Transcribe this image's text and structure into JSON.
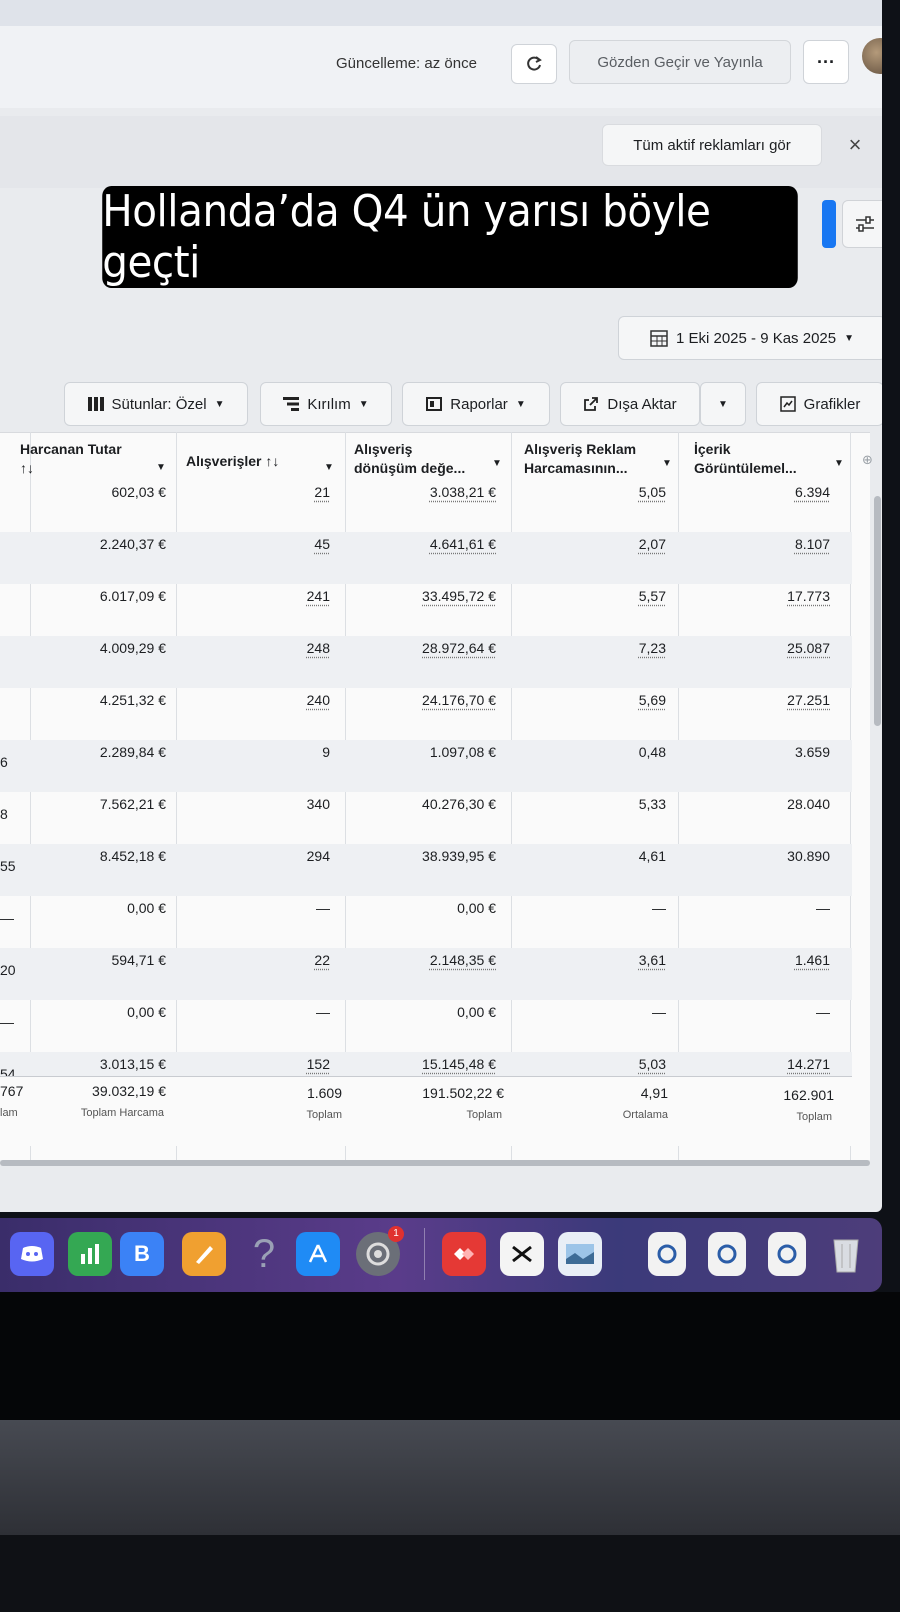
{
  "header": {
    "update_status": "Güncelleme: az önce",
    "review_publish": "Gözden Geçir ve Yayınla",
    "more": "···"
  },
  "banner": {
    "all_active_ads": "Tüm aktif reklamları gör",
    "close": "×"
  },
  "overlay_caption": "Hollanda’da Q4 ün yarısı böyle geçti",
  "date_range": "1 Eki 2025 - 9 Kas 2025",
  "toolbar": {
    "columns": "Sütunlar: Özel",
    "breakdown": "Kırılım",
    "reports": "Raporlar",
    "export": "Dışa Aktar",
    "charts": "Grafikler"
  },
  "table": {
    "headers": [
      {
        "line1": "Harcanan Tutar",
        "line2": "↑↓"
      },
      {
        "line1": "Alışverişler ↑↓",
        "line2": ""
      },
      {
        "line1": "Alışveriş",
        "line2": "dönüşüm değe..."
      },
      {
        "line1": "Alışveriş Reklam",
        "line2": "Harcamasının..."
      },
      {
        "line1": "İçerik",
        "line2": "Görüntülemel..."
      }
    ],
    "rows": [
      {
        "cut": "",
        "spend": "602,03 €",
        "purchases": "21",
        "value": "3.038,21 €",
        "roas": "5,05",
        "views": "6.394"
      },
      {
        "cut": "",
        "spend": "2.240,37 €",
        "purchases": "45",
        "value": "4.641,61 €",
        "roas": "2,07",
        "views": "8.107"
      },
      {
        "cut": "",
        "spend": "6.017,09 €",
        "purchases": "241",
        "value": "33.495,72 €",
        "roas": "5,57",
        "views": "17.773"
      },
      {
        "cut": "",
        "spend": "4.009,29 €",
        "purchases": "248",
        "value": "28.972,64 €",
        "roas": "7,23",
        "views": "25.087"
      },
      {
        "cut": "",
        "spend": "4.251,32 €",
        "purchases": "240",
        "value": "24.176,70 €",
        "roas": "5,69",
        "views": "27.251"
      },
      {
        "cut": "6",
        "spend": "2.289,84 €",
        "purchases": "9",
        "value": "1.097,08 €",
        "roas": "0,48",
        "views": "3.659"
      },
      {
        "cut": "8",
        "spend": "7.562,21 €",
        "purchases": "340",
        "value": "40.276,30 €",
        "roas": "5,33",
        "views": "28.040"
      },
      {
        "cut": "55",
        "spend": "8.452,18 €",
        "purchases": "294",
        "value": "38.939,95 €",
        "roas": "4,61",
        "views": "30.890"
      },
      {
        "cut": "—",
        "spend": "0,00 €",
        "purchases": "—",
        "value": "0,00 €",
        "roas": "—",
        "views": "—"
      },
      {
        "cut": "20",
        "spend": "594,71 €",
        "purchases": "22",
        "value": "2.148,35 €",
        "roas": "3,61",
        "views": "1.461"
      },
      {
        "cut": "—",
        "spend": "0,00 €",
        "purchases": "—",
        "value": "0,00 €",
        "roas": "—",
        "views": "—"
      },
      {
        "cut": "54",
        "spend": "3.013,15 €",
        "purchases": "152",
        "value": "15.145,48 €",
        "roas": "5,03",
        "views": "14.271"
      }
    ],
    "totals": {
      "cut": "767",
      "cut_label": "lam",
      "spend": "39.032,19 €",
      "spend_label": "Toplam Harcama",
      "purchases": "1.609",
      "purchases_label": "Toplam",
      "value": "191.502,22 €",
      "value_label": "Toplam",
      "roas": "4,91",
      "roas_label": "Ortalama",
      "views": "162.901",
      "views_label": "Toplam"
    }
  },
  "dock": {
    "badge": "1",
    "items": [
      "discord-icon",
      "numbers-icon",
      "b-app-icon",
      "pages-icon",
      "help-icon",
      "app-store-icon",
      "system-settings-icon",
      "anydesk-icon",
      "capcut-icon",
      "preview-icon",
      "doc-icon",
      "doc-icon",
      "doc-icon",
      "trash-icon"
    ]
  },
  "colors": {
    "accent": "#1877f2",
    "overlay_bg": "#000000",
    "dock_purple": "#5a3c8a"
  }
}
